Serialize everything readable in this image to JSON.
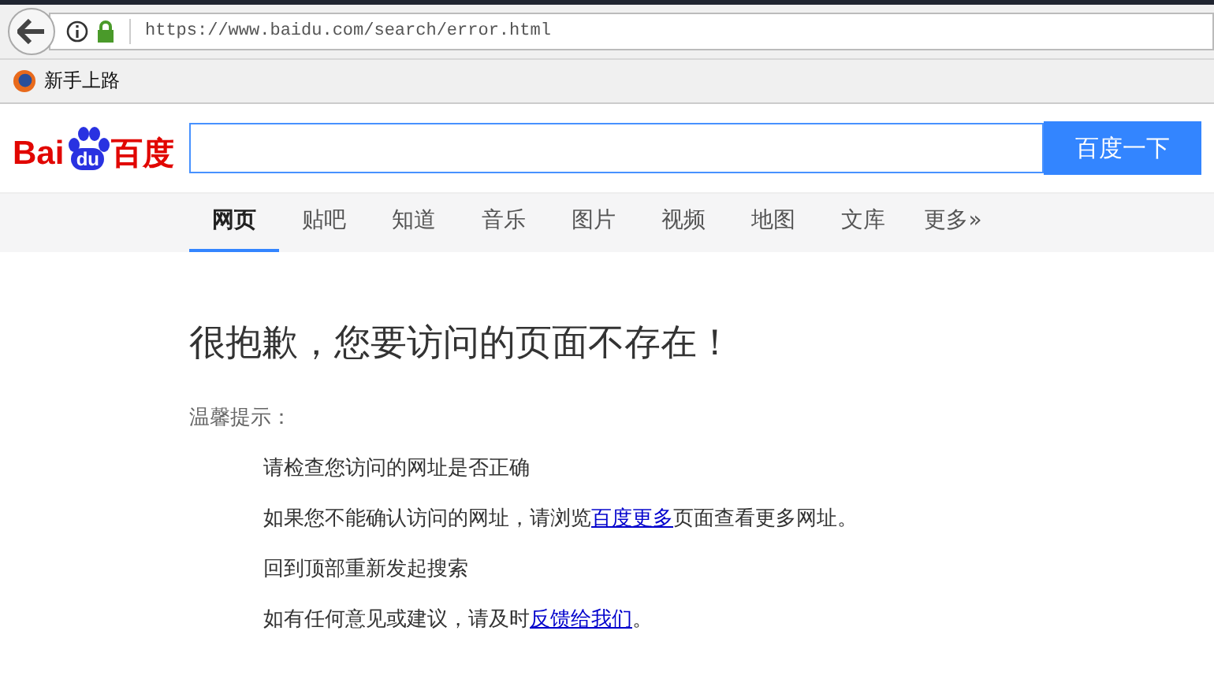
{
  "browser": {
    "url": "https://www.baidu.com/search/error.html",
    "bookmarks": [
      {
        "label": "新手上路"
      }
    ]
  },
  "logo": {
    "part_1": "Bai",
    "part_2": "du",
    "part_3": "百度"
  },
  "search": {
    "button": "百度一下"
  },
  "tabs": [
    {
      "label": "网页",
      "selected": true
    },
    {
      "label": "贴吧",
      "selected": false
    },
    {
      "label": "知道",
      "selected": false
    },
    {
      "label": "音乐",
      "selected": false
    },
    {
      "label": "图片",
      "selected": false
    },
    {
      "label": "视频",
      "selected": false
    },
    {
      "label": "地图",
      "selected": false
    },
    {
      "label": "文库",
      "selected": false
    },
    {
      "label": "更多»",
      "selected": false
    }
  ],
  "heading": "很抱歉，您要访问的页面不存在！",
  "tips_label": "温馨提示：",
  "tips": [
    {
      "before": "请检查您访问的网址是否正确"
    },
    {
      "before": "如果您不能确认访问的网址，请浏览",
      "link": "百度更多",
      "after": "页面查看更多网址。"
    },
    {
      "before": "回到顶部重新发起搜索"
    },
    {
      "before": "如有任何意见或建议，请及时",
      "link": "反馈给我们",
      "after": "。"
    }
  ]
}
